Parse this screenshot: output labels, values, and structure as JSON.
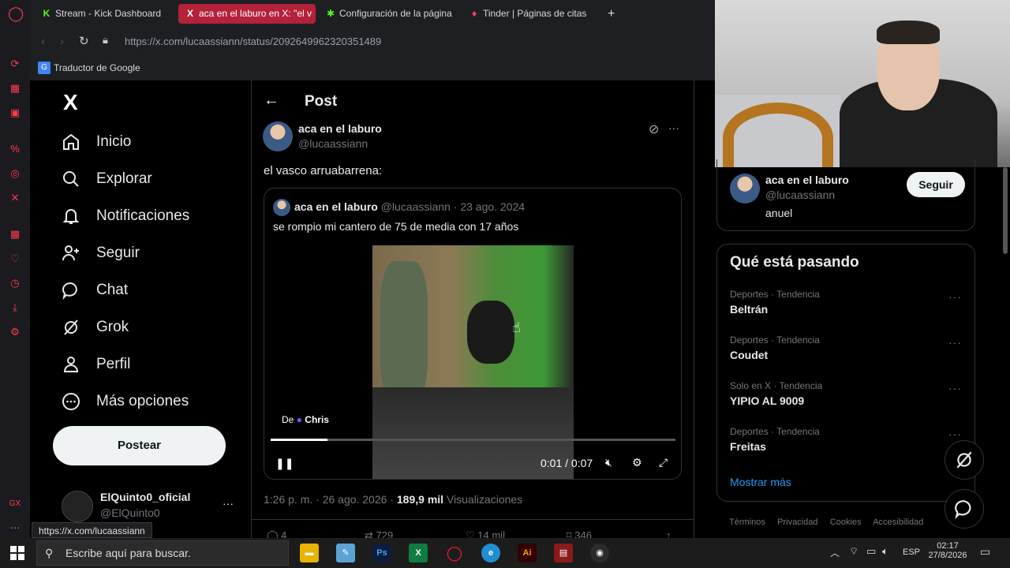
{
  "browser": {
    "tabs": [
      {
        "label": "Stream - Kick Dashboard",
        "icon": "kick-icon"
      },
      {
        "label": "aca en el laburo en X: \"el v",
        "icon": "x-icon"
      },
      {
        "label": "Configuración de la página",
        "icon": "kick-icon"
      },
      {
        "label": "Tinder | Páginas de citas",
        "icon": "tinder-icon"
      }
    ],
    "new_tab": "+",
    "url": "https://x.com/lucaassiann/status/2092649962320351489",
    "bookmark": "Traductor de Google",
    "status_url": "https://x.com/lucaassiann"
  },
  "nav": {
    "logo": "X",
    "items": [
      {
        "label": "Inicio",
        "icon": "home-icon"
      },
      {
        "label": "Explorar",
        "icon": "search-icon"
      },
      {
        "label": "Notificaciones",
        "icon": "bell-icon"
      },
      {
        "label": "Seguir",
        "icon": "add-user-icon"
      },
      {
        "label": "Chat",
        "icon": "chat-icon"
      },
      {
        "label": "Grok",
        "icon": "grok-icon"
      },
      {
        "label": "Perfil",
        "icon": "person-icon"
      },
      {
        "label": "Más opciones",
        "icon": "more-icon"
      }
    ],
    "post_button": "Postear",
    "account_name": "ElQuinto0_oficial",
    "account_handle": "@ElQuinto0"
  },
  "post": {
    "header": "Post",
    "author": "aca en el laburo",
    "handle": "@lucaassiann",
    "text": "el vasco arruabarrena:",
    "quote": {
      "author": "aca en el laburo",
      "handle": "@lucaassiann",
      "date": "· 23 ago. 2024",
      "text": "se rompio mi cantero de 75 de media con 17 años"
    },
    "video": {
      "source_prefix": "De",
      "source_name": "Chris",
      "time": "0:01 / 0:07",
      "progress": 0.14
    },
    "meta_time": "1:26 p. m. · 26 ago. 2026 ·",
    "views_count": "189,9 mil",
    "views_label": "Visualizaciones",
    "actions": {
      "replies": "4",
      "reposts": "729",
      "likes": "14 mil",
      "bookmarks": "346"
    }
  },
  "right": {
    "profile": {
      "name": "aca en el laburo",
      "handle": "@lucaassiann",
      "bio": "anuel",
      "follow": "Seguir"
    },
    "trends_title": "Qué está pasando",
    "trends": [
      {
        "category": "Deportes · Tendencia",
        "name": "Beltrán"
      },
      {
        "category": "Deportes · Tendencia",
        "name": "Coudet"
      },
      {
        "category": "Solo en X · Tendencia",
        "name": "YIPIO AL 9009"
      },
      {
        "category": "Deportes · Tendencia",
        "name": "Freitas"
      }
    ],
    "show_more": "Mostrar más",
    "footer": [
      "Términos",
      "Privacidad",
      "Cookies",
      "Accesibilidad"
    ]
  },
  "taskbar": {
    "search_placeholder": "Escribe aquí para buscar.",
    "lang": "ESP",
    "time": "02:17",
    "date": "27/8/2026"
  },
  "colors": {
    "accent": "#1d9bf0",
    "opera_red": "#ff1b2d",
    "tab_active": "#b4213a"
  }
}
